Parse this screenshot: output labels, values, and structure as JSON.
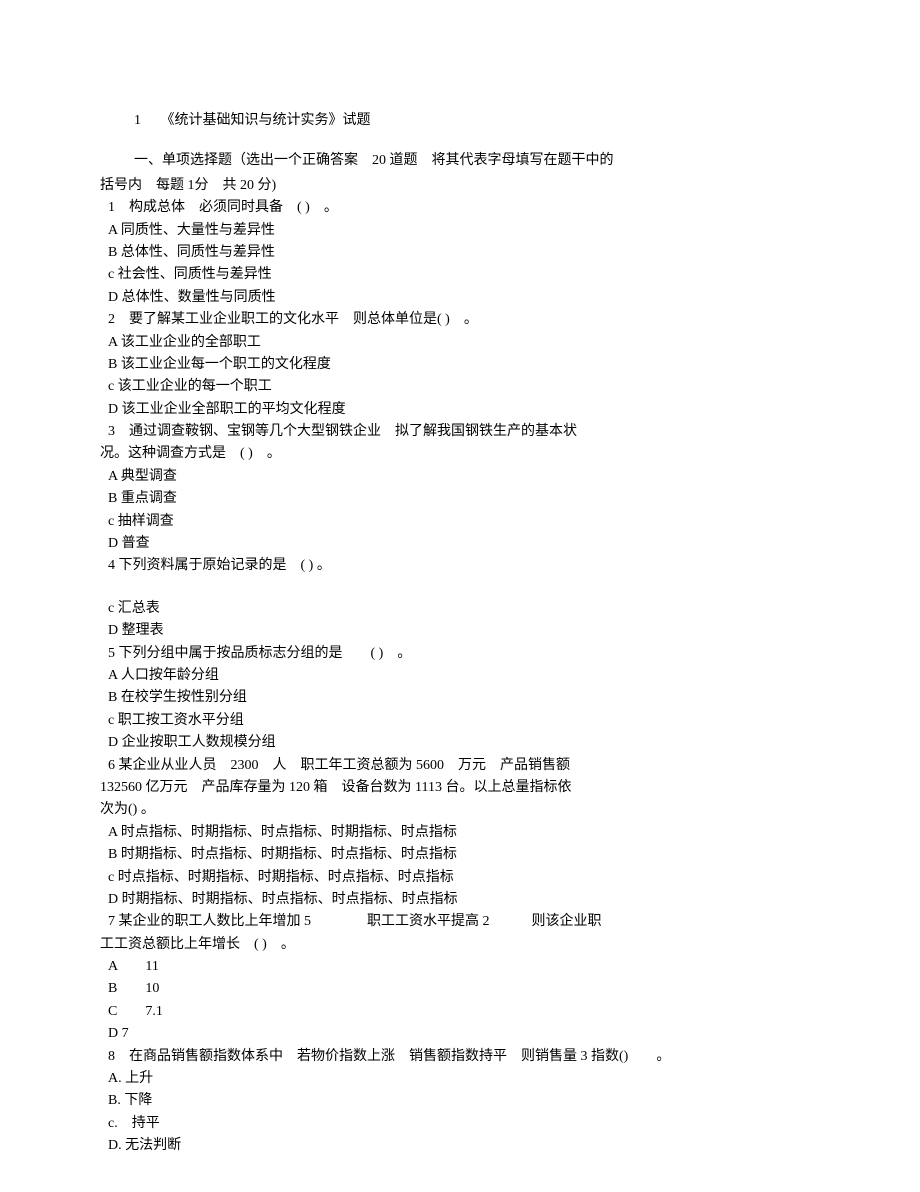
{
  "title": {
    "num": "1",
    "text": "《统计基础知识与统计实务》试题"
  },
  "sectionHeader": {
    "line1": "一、单项选择题（选出一个正确答案　20 道题　将其代表字母填写在题干中的",
    "line2": "括号内　每题 1分　共  20 分)"
  },
  "q1": {
    "stem": "1　构成总体　必须同时具备　( )　。",
    "A": "A  同质性、大量性与差异性",
    "B": "B  总体性、同质性与差异性",
    "c": "c  社会性、同质性与差异性",
    "D": "D 总体性、数量性与同质性"
  },
  "q2": {
    "stem": "2　要了解某工业企业职工的文化水平　则总体单位是( )　。",
    "A": "A  该工业企业的全部职工",
    "B": "B  该工业企业每一个职工的文化程度",
    "c": "c 该工业企业的每一个职工",
    "D": "D  该工业企业全部职工的平均文化程度"
  },
  "q3": {
    "stem1": "3　通过调查鞍钢、宝钢等几个大型钢铁企业　拟了解我国钢铁生产的基本状",
    "stem2": "况。这种调查方式是　( )　。",
    "A": "A  典型调查",
    "B": "B  重点调查",
    "c": "c 抽样调查",
    "D": "D  普查"
  },
  "q4": {
    "stem": "4  下列资料属于原始记录的是　( ) 。",
    "c": "c  汇总表",
    "D": "D  整理表"
  },
  "q5": {
    "stem": "5  下列分组中属于按品质标志分组的是　　( )　。",
    "A": "A  人口按年龄分组",
    "B": "B  在校学生按性别分组",
    "c": "c 职工按工资水平分组",
    "D": "D  企业按职工人数规模分组"
  },
  "q6": {
    "stem1": "6  某企业从业人员　2300　人　职工年工资总额为 5600　万元　产品销售额",
    "stem2": "132560 亿万元　产品库存量为 120 箱　设备台数为 1113 台。以上总量指标依",
    "stem3": "次为() 。",
    "A": "A  时点指标、时期指标、时点指标、时期指标、时点指标",
    "B": "B  时期指标、时点指标、时期指标、时点指标、时点指标",
    "c": "c 时点指标、时期指标、时期指标、时点指标、时点指标",
    "D": "D  时期指标、时期指标、时点指标、时点指标、时点指标"
  },
  "q7": {
    "stem1": "7  某企业的职工人数比上年增加 5　　　　职工工资水平提高 2　　　则该企业职",
    "stem2": "工工资总额比上年增长　( )　。",
    "A": "A　　11",
    "B": "B　　10",
    "C": "C　　7.1",
    "D": "D 7"
  },
  "q8": {
    "stem": "8　在商品销售额指数体系中　若物价指数上涨　销售额指数持平　则销售量  3  指数()　　。",
    "A": "A.  上升",
    "B": "B.  下降",
    "c": "c.　持平",
    "D": "D.  无法判断"
  }
}
